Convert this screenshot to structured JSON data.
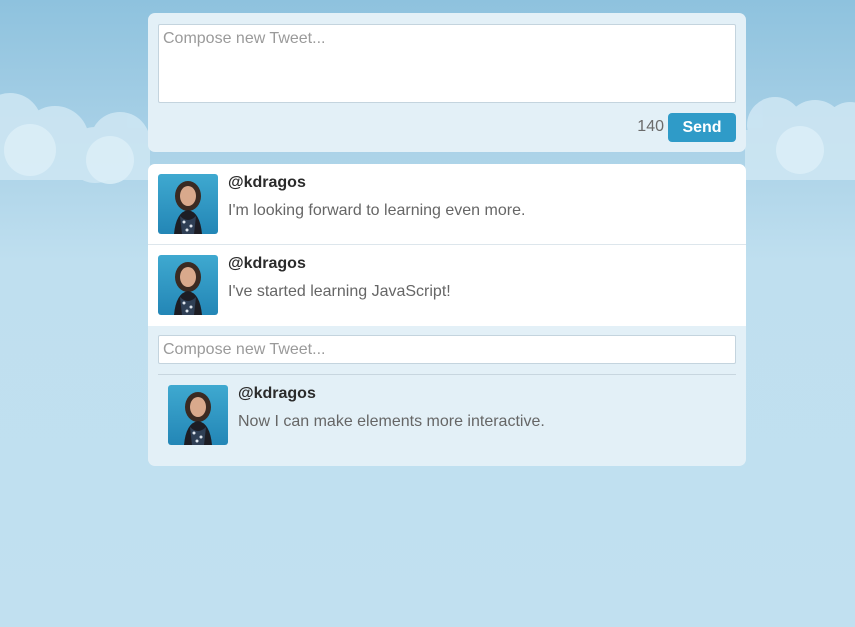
{
  "colors": {
    "accent": "#2f9bc8",
    "panel_background": "#e3f0f7",
    "sky_background": "#c1e0f0"
  },
  "compose": {
    "placeholder": "Compose new Tweet...",
    "char_count": "140",
    "send_label": "Send"
  },
  "feed": {
    "tweets": [
      {
        "user": "@kdragos",
        "text": "I'm looking forward to learning even more."
      },
      {
        "user": "@kdragos",
        "text": "I've started learning JavaScript!"
      }
    ],
    "reply_placeholder": "Compose new Tweet...",
    "reply": {
      "user": "@kdragos",
      "text": "Now I can make elements more interactive."
    }
  }
}
